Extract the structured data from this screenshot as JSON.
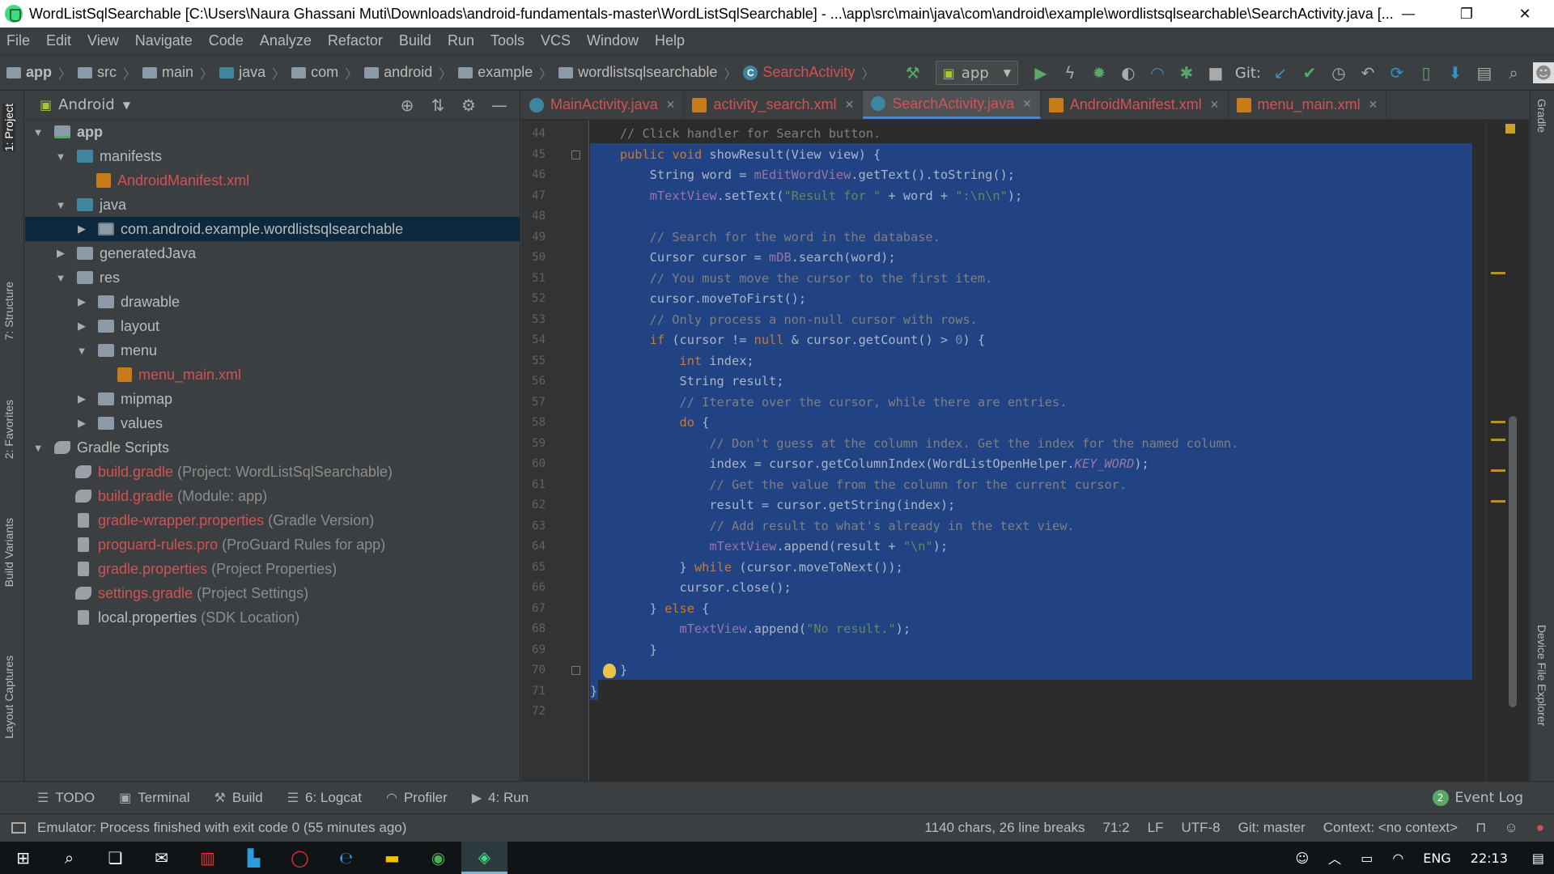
{
  "window": {
    "title": "WordListSqlSearchable [C:\\Users\\Naura Ghassani Muti\\Downloads\\android-fundamentals-master\\WordListSqlSearchable] - ...\\app\\src\\main\\java\\com\\android\\example\\wordlistsqlsearchable\\SearchActivity.java [...",
    "minimize": "—",
    "maximize": "❐",
    "close": "✕"
  },
  "menu": [
    "File",
    "Edit",
    "View",
    "Navigate",
    "Code",
    "Analyze",
    "Refactor",
    "Build",
    "Run",
    "Tools",
    "VCS",
    "Window",
    "Help"
  ],
  "breadcrumbs": [
    "app",
    "src",
    "main",
    "java",
    "com",
    "android",
    "example",
    "wordlistsqlsearchable",
    "SearchActivity"
  ],
  "toolbar": {
    "run_config": "app",
    "git_label": "Git:"
  },
  "left_tabs": [
    "1: Project",
    "7: Structure",
    "2: Favorites",
    "Build Variants",
    "Layout Captures"
  ],
  "right_tabs": [
    "Gradle",
    "Device File Explorer"
  ],
  "project": {
    "view": "Android",
    "tree": [
      {
        "label": "app",
        "extra": ""
      },
      {
        "label": "manifests",
        "extra": ""
      },
      {
        "label": "AndroidManifest.xml",
        "extra": ""
      },
      {
        "label": "java",
        "extra": ""
      },
      {
        "label": "com.android.example.wordlistsqlsearchable",
        "extra": ""
      },
      {
        "label": "generatedJava",
        "extra": ""
      },
      {
        "label": "res",
        "extra": ""
      },
      {
        "label": "drawable",
        "extra": ""
      },
      {
        "label": "layout",
        "extra": ""
      },
      {
        "label": "menu",
        "extra": ""
      },
      {
        "label": "menu_main.xml",
        "extra": ""
      },
      {
        "label": "mipmap",
        "extra": ""
      },
      {
        "label": "values",
        "extra": ""
      },
      {
        "label": "Gradle Scripts",
        "extra": ""
      },
      {
        "label": "build.gradle",
        "extra": "(Project: WordListSqlSearchable)"
      },
      {
        "label": "build.gradle",
        "extra": "(Module: app)"
      },
      {
        "label": "gradle-wrapper.properties",
        "extra": "(Gradle Version)"
      },
      {
        "label": "proguard-rules.pro",
        "extra": "(ProGuard Rules for app)"
      },
      {
        "label": "gradle.properties",
        "extra": "(Project Properties)"
      },
      {
        "label": "settings.gradle",
        "extra": "(Project Settings)"
      },
      {
        "label": "local.properties",
        "extra": "(SDK Location)"
      }
    ]
  },
  "editor": {
    "tabs": [
      "MainActivity.java",
      "activity_search.xml",
      "SearchActivity.java",
      "AndroidManifest.xml",
      "menu_main.xml"
    ],
    "line_numbers": [
      "44",
      "45",
      "46",
      "47",
      "48",
      "49",
      "50",
      "51",
      "52",
      "53",
      "54",
      "55",
      "56",
      "57",
      "58",
      "59",
      "60",
      "61",
      "62",
      "63",
      "64",
      "65",
      "66",
      "67",
      "68",
      "69",
      "70",
      "71",
      "72"
    ],
    "code": [
      "    // Click handler for Search button.",
      "    public void showResult(View view) {",
      "        String word = mEditWordView.getText().toString();",
      "        mTextView.setText(\"Result for \" + word + \":\\n\\n\");",
      "",
      "        // Search for the word in the database.",
      "        Cursor cursor = mDB.search(word);",
      "        // You must move the cursor to the first item.",
      "        cursor.moveToFirst();",
      "        // Only process a non-null cursor with rows.",
      "        if (cursor != null & cursor.getCount() > 0) {",
      "            int index;",
      "            String result;",
      "            // Iterate over the cursor, while there are entries.",
      "            do {",
      "                // Don't guess at the column index. Get the index for the named column.",
      "                index = cursor.getColumnIndex(WordListOpenHelper.KEY_WORD);",
      "                // Get the value from the column for the current cursor.",
      "                result = cursor.getString(index);",
      "                // Add result to what's already in the text view.",
      "                mTextView.append(result + \"\\n\");",
      "            } while (cursor.moveToNext());",
      "            cursor.close();",
      "        } else {",
      "            mTextView.append(\"No result.\");",
      "        }",
      "    }",
      "}",
      ""
    ]
  },
  "bottom_tabs": [
    "TODO",
    "Terminal",
    "Build",
    "6: Logcat",
    "Profiler",
    "4: Run"
  ],
  "event_log": {
    "label": "Event Log",
    "count": "2"
  },
  "status": {
    "message": "Emulator: Process finished with exit code 0 (55 minutes ago)",
    "chars": "1140 chars, 26 line breaks",
    "position": "71:2",
    "line_sep": "LF",
    "encoding": "UTF-8",
    "git": "Git: master",
    "context": "Context: <no context>"
  },
  "taskbar": {
    "lang": "ENG",
    "time": "22:13"
  },
  "colors": {
    "selection": "#214283",
    "keyword": "#cc7832",
    "comment": "#808080",
    "field": "#9876aa",
    "string": "#6a8759",
    "number": "#6897bb",
    "error_red": "#d25252"
  }
}
